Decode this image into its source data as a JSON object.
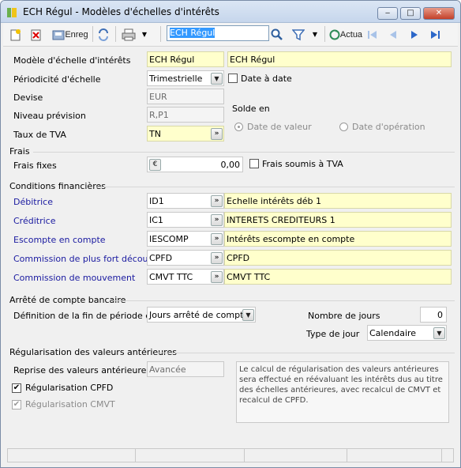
{
  "window": {
    "title": "ECH Régul - Modèles d'échelles d'intérêts",
    "buttons": {
      "minimize": "‒",
      "maximize": "□",
      "close": "✕"
    }
  },
  "toolbar": {
    "save_label": "Enreg",
    "search_value": "ECH Régul",
    "actualize_label": "Actua"
  },
  "form": {
    "modele_label": "Modèle d'échelle d'intérêts",
    "modele_code": "ECH Régul",
    "modele_name": "ECH Régul",
    "periodicite_label": "Périodicité d'échelle",
    "periodicite_value": "Trimestrielle",
    "date_a_date_label": "Date à date",
    "devise_label": "Devise",
    "devise_value": "EUR",
    "niveau_label": "Niveau prévision",
    "niveau_value": "R,P1",
    "solde_label": "Solde en",
    "date_valeur_label": "Date de valeur",
    "date_operation_label": "Date d'opération",
    "tva_label": "Taux de TVA",
    "tva_value": "TN"
  },
  "frais": {
    "section": "Frais",
    "fixes_label": "Frais fixes",
    "currency_icon": "€",
    "fixes_value": "0,00",
    "soumis_label": "Frais soumis à TVA"
  },
  "conditions": {
    "section": "Conditions financières",
    "rows": [
      {
        "label": "Débitrice",
        "code": "ID1",
        "desc": "Echelle intérêts déb 1"
      },
      {
        "label": "Créditrice",
        "code": "IC1",
        "desc": "INTERETS CREDITEURS 1"
      },
      {
        "label": "Escompte en compte",
        "code": "IESCOMP",
        "desc": "Intérêts escompte en compte"
      },
      {
        "label": "Commission de plus fort découvert",
        "code": "CPFD",
        "desc": "CPFD"
      },
      {
        "label": "Commission de mouvement",
        "code": "CMVT TTC",
        "desc": "CMVT TTC"
      }
    ]
  },
  "arrete": {
    "section": "Arrêté de compte bancaire",
    "definition_label": "Définition de la fin de période en",
    "definition_value": "Jours arrêté de compte",
    "nombre_label": "Nombre de jours",
    "nombre_value": "0",
    "type_label": "Type de jour",
    "type_value": "Calendaire"
  },
  "regularisation": {
    "section": "Régularisation des valeurs antérieures",
    "reprise_label": "Reprise des valeurs antérieures",
    "reprise_value": "Avancée",
    "cpfd_label": "Régularisation CPFD",
    "cmvt_label": "Régularisation CMVT",
    "note": "Le calcul de régularisation des valeurs antérieures sera effectué en réévaluant les intérêts dus au titre des échelles antérieures, avec recalcul de CMVT et recalcul de CPFD."
  }
}
